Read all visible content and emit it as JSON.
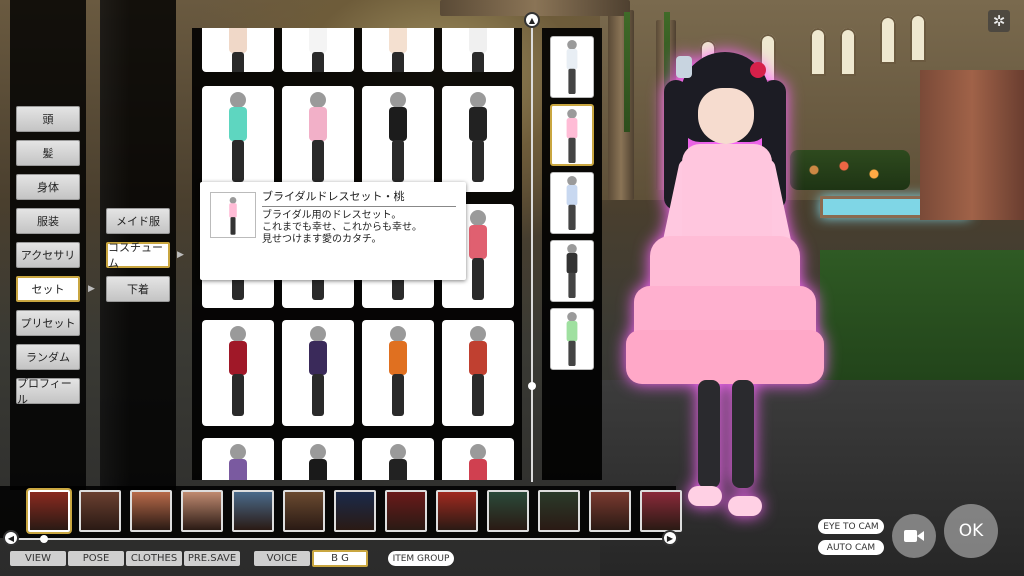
{
  "categories": [
    {
      "label": "頭",
      "selected": false
    },
    {
      "label": "髪",
      "selected": false
    },
    {
      "label": "身体",
      "selected": false
    },
    {
      "label": "服装",
      "selected": false
    },
    {
      "label": "アクセサリ",
      "selected": false
    },
    {
      "label": "セット",
      "selected": true
    },
    {
      "label": "プリセット",
      "selected": false
    },
    {
      "label": "ランダム",
      "selected": false
    },
    {
      "label": "プロフィール",
      "selected": false
    }
  ],
  "subcategories": [
    {
      "label": "メイド服",
      "selected": false
    },
    {
      "label": "コスチューム",
      "selected": true
    },
    {
      "label": "下着",
      "selected": false
    }
  ],
  "tooltip": {
    "title": "ブライダルドレスセット・桃",
    "lines": [
      "ブライダル用のドレスセット。",
      "これまでも幸せ、これからも幸せ。",
      "見せつけます愛のカタチ。"
    ]
  },
  "tabs": {
    "view": "VIEW",
    "pose": "POSE",
    "clothes": "CLOTHES",
    "pre_save": "PRE.SAVE",
    "voice": "VOICE",
    "bg": "B G",
    "item_group": "ITEM GROUP",
    "active": "bg"
  },
  "camera": {
    "eye_to_cam": "EYE TO CAM",
    "auto_cam": "AUTO CAM"
  },
  "ok_label": "OK",
  "icons": {
    "scroll_up": "chevron-up-icon",
    "scroll_left": "chevron-left-icon",
    "scroll_right": "chevron-right-icon",
    "camera": "video-camera-icon",
    "settings": "gear-icon"
  },
  "colors": {
    "selection_border": "#c9a640",
    "button_bg": "#d4d4d4",
    "panel_bg": "#000000",
    "dress_pink": "#ffbcd6"
  }
}
